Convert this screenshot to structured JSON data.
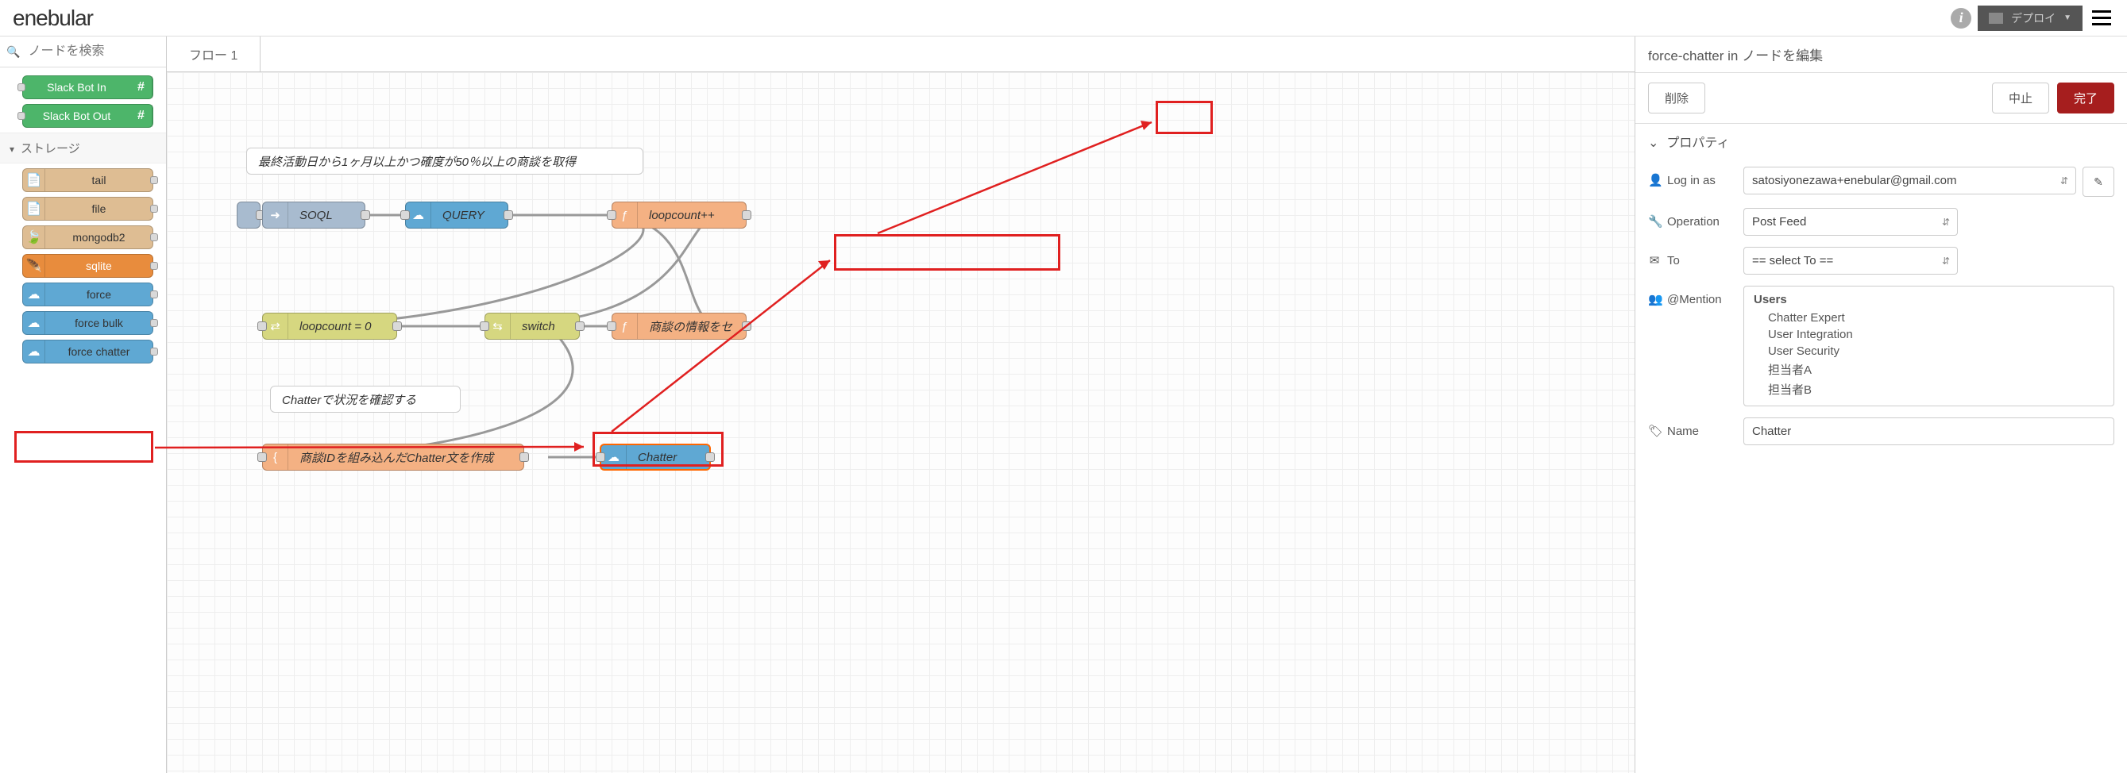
{
  "brand": "enebular",
  "deploy_label": "デプロイ",
  "search_placeholder": "ノードを検索",
  "palette": {
    "slack_in": "Slack Bot In",
    "slack_out": "Slack Bot Out",
    "cat_storage": "ストレージ",
    "tail": "tail",
    "file": "file",
    "mongodb2": "mongodb2",
    "sqlite": "sqlite",
    "force": "force",
    "force_bulk": "force bulk",
    "force_chatter": "force chatter"
  },
  "tab_label": "フロー 1",
  "flow": {
    "comment1": "最終活動日から1ヶ月以上かつ確度が50％以上の商談を取得",
    "soql": "SOQL",
    "query": "QUERY",
    "loopcount_inc": "loopcount++",
    "loopcount_zero": "loopcount = 0",
    "switch": "switch",
    "set_info": "商談の情報をセ",
    "comment2": "Chatterで状況を確認する",
    "build_chatter": "商談IDを組み込んだChatter文を作成",
    "chatter": "Chatter"
  },
  "sidebar": {
    "title": "force-chatter in ノードを編集",
    "delete": "削除",
    "cancel": "中止",
    "done": "完了",
    "properties": "プロパティ",
    "login_as_label": "Log in as",
    "login_as_value": "satosiyonezawa+enebular@gmail.com",
    "operation_label": "Operation",
    "operation_value": "Post Feed",
    "to_label": "To",
    "to_value": "== select To ==",
    "mention_label": "@Mention",
    "mention_group": "Users",
    "mention_items": [
      "Chatter Expert",
      "User Integration",
      "User Security",
      "担当者A",
      "担当者B"
    ],
    "name_label": "Name",
    "name_value": "Chatter"
  }
}
